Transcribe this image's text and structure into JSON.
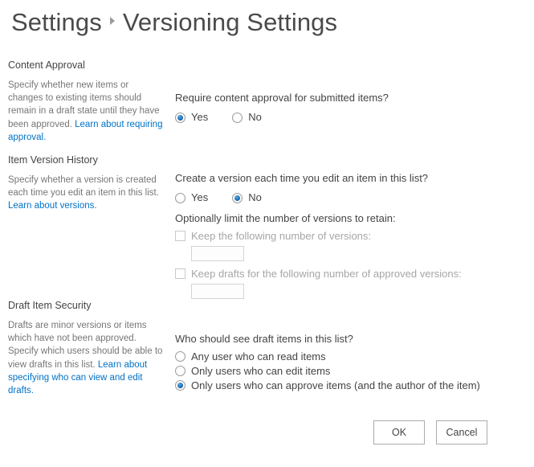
{
  "header": {
    "breadcrumb_parent": "Settings",
    "separator_icon": "triangle-right-icon",
    "breadcrumb_current": "Versioning Settings"
  },
  "colors": {
    "link": "#0072C6",
    "radio_selected": "#1E72B8",
    "text": "#444444",
    "muted_text": "#767676",
    "disabled_text": "#A6A6A6",
    "background": "#FFFFFF"
  },
  "sections": {
    "content_approval": {
      "title": "Content Approval",
      "description_before_link": "Specify whether new items or changes to existing items should remain in a draft state until they have been approved.",
      "link_text": "Learn about requiring approval.",
      "question": "Require content approval for submitted items?",
      "options": [
        {
          "label": "Yes",
          "selected": true
        },
        {
          "label": "No",
          "selected": false
        }
      ]
    },
    "item_version_history": {
      "title": "Item Version History",
      "description_before_link": "Specify whether a version is created each time you edit an item in this list.",
      "link_text": "Learn about versions.",
      "question": "Create a version each time you edit an item in this list?",
      "options": [
        {
          "label": "Yes",
          "selected": false
        },
        {
          "label": "No",
          "selected": true
        }
      ],
      "sub_question": "Optionally limit the number of versions to retain:",
      "limits": [
        {
          "checkbox_label": "Keep the following number of versions:",
          "checked": false,
          "disabled": true,
          "input_value": "",
          "input_placeholder": ""
        },
        {
          "checkbox_label": "Keep drafts for the following number of approved versions:",
          "checked": false,
          "disabled": true,
          "input_value": "",
          "input_placeholder": ""
        }
      ]
    },
    "draft_item_security": {
      "title": "Draft Item Security",
      "description_before_link": "Drafts are minor versions or items which have not been approved. Specify which users should be able to view drafts in this list.",
      "link_text": "Learn about specifying who can view and edit drafts.",
      "question": "Who should see draft items in this list?",
      "options": [
        {
          "label": "Any user who can read items",
          "selected": false
        },
        {
          "label": "Only users who can edit items",
          "selected": false
        },
        {
          "label": "Only users who can approve items (and the author of the item)",
          "selected": true
        }
      ]
    }
  },
  "footer": {
    "ok_label": "OK",
    "cancel_label": "Cancel"
  }
}
